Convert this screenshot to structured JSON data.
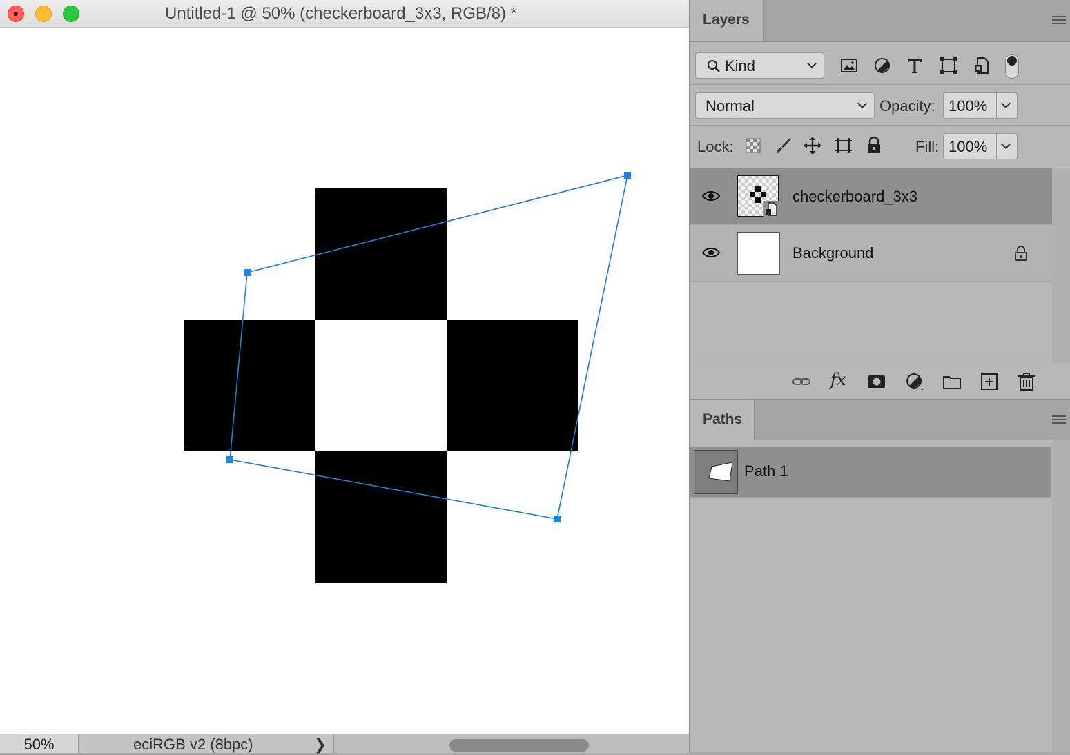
{
  "document": {
    "title": "Untitled-1 @ 50% (checkerboard_3x3, RGB/8) *",
    "zoom": "50%",
    "color_profile": "eciRGB v2 (8bpc)",
    "status_arrow": "❯"
  },
  "layers_panel": {
    "tab_label": "Layers",
    "filter_kind": "Kind",
    "blend_mode": "Normal",
    "opacity_label": "Opacity:",
    "opacity_value": "100%",
    "lock_label": "Lock:",
    "fill_label": "Fill:",
    "fill_value": "100%",
    "layers": [
      {
        "name": "checkerboard_3x3",
        "visible": true,
        "selected": true,
        "type": "smart-object"
      },
      {
        "name": "Background",
        "visible": true,
        "selected": false,
        "locked": true
      }
    ],
    "footer_fx_label": "fx"
  },
  "paths_panel": {
    "tab_label": "Paths",
    "paths": [
      {
        "name": "Path 1",
        "selected": true
      }
    ]
  },
  "colors": {
    "path_stroke": "#1f7fd4",
    "anchor": "#1a86ea",
    "checker_fill": "#000000"
  }
}
